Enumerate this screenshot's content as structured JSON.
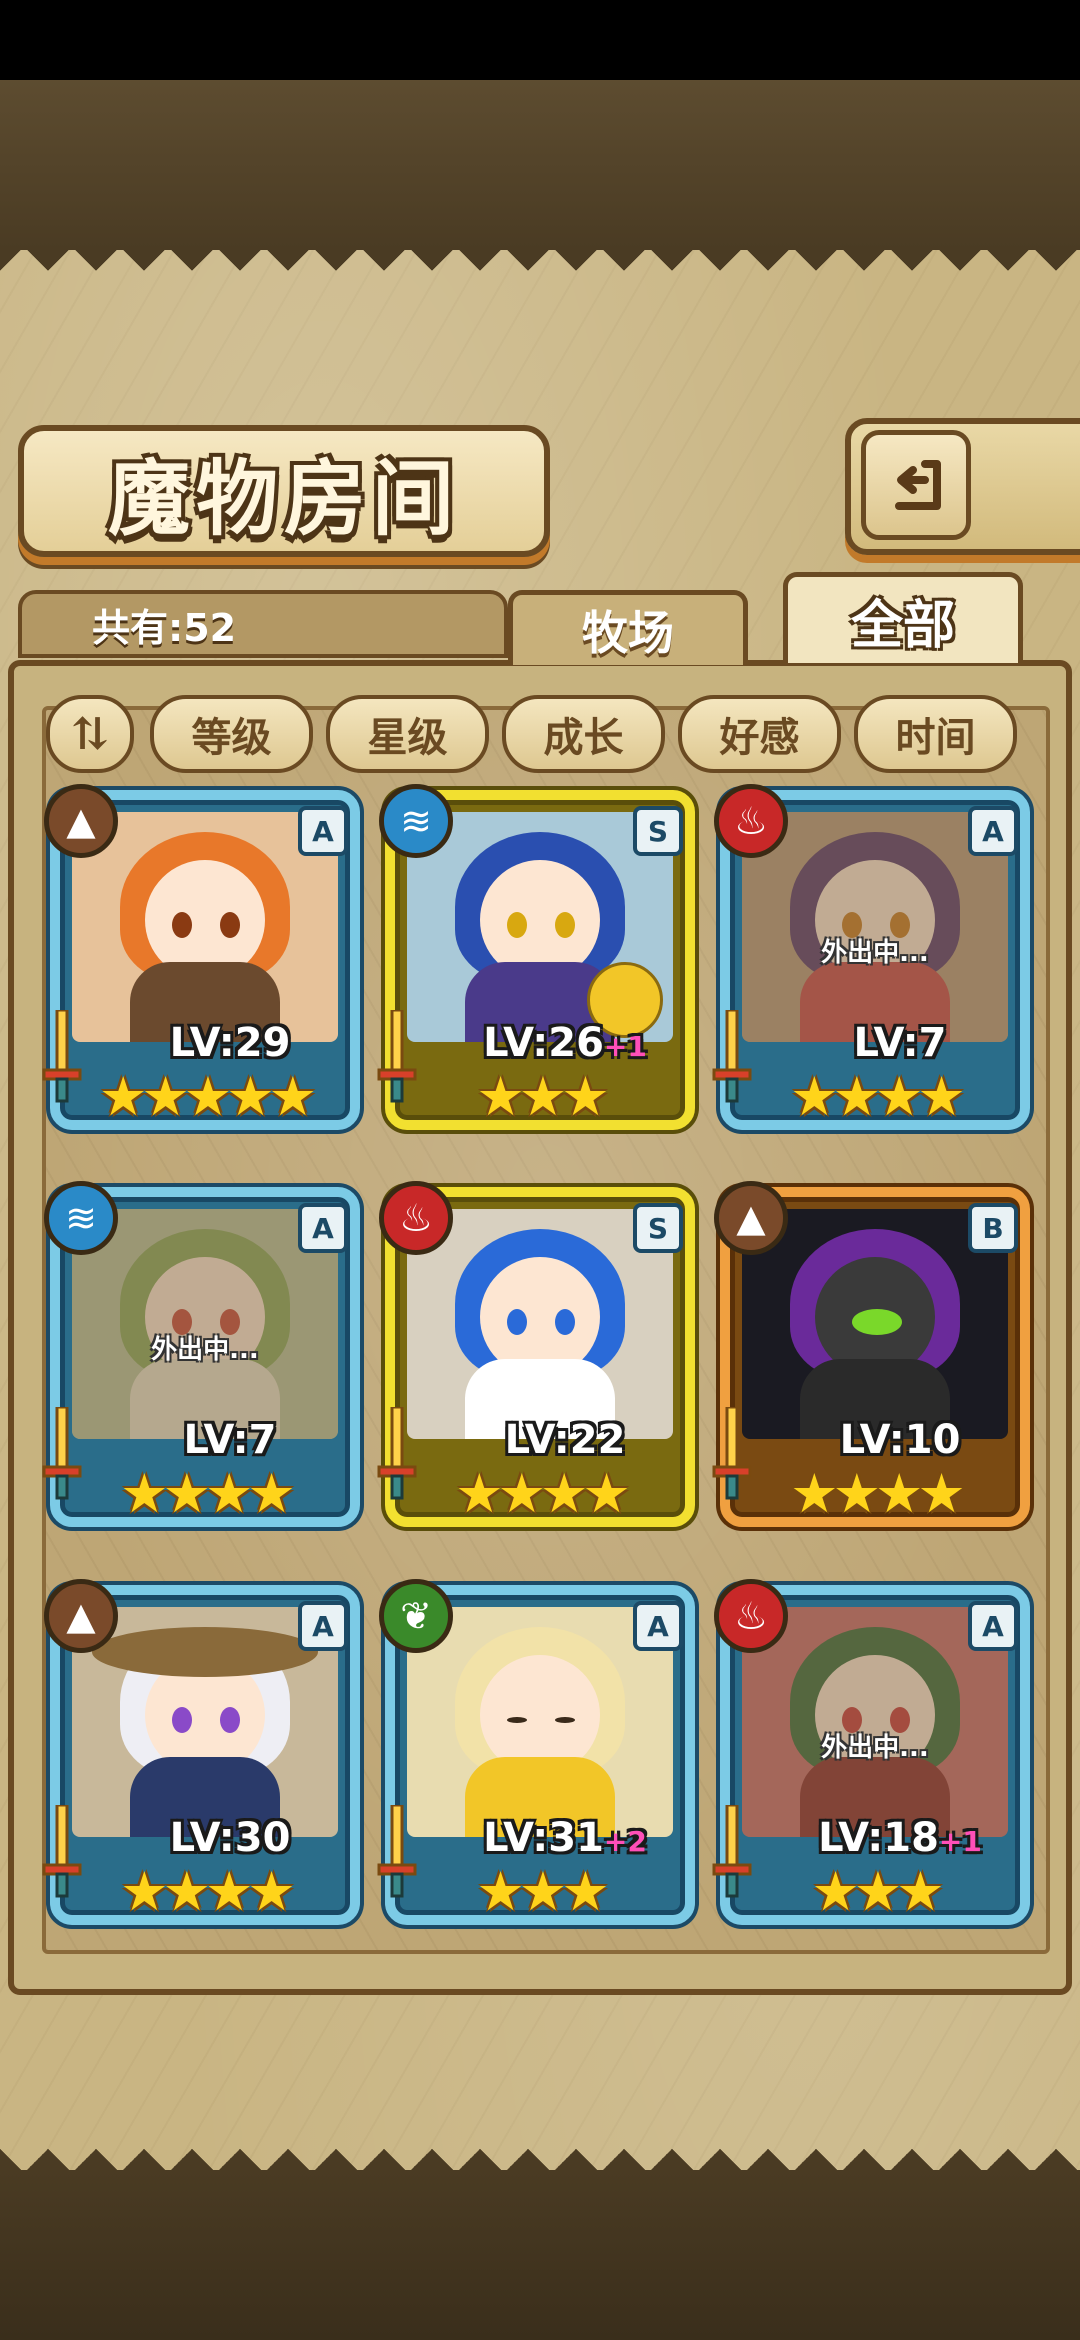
{
  "title": "魔物房间",
  "total_count": "共有:52",
  "tabs": [
    {
      "label": "牧场",
      "active": false
    },
    {
      "label": "全部",
      "active": true
    }
  ],
  "sort_toggle": "⇅",
  "filters": [
    "等级",
    "星级",
    "成长",
    "好感",
    "时间"
  ],
  "monsters": [
    {
      "element": "earth",
      "rarity": "A",
      "level": "LV:29",
      "plus": "",
      "stars": "★★★★★",
      "away": "",
      "frame": "blue"
    },
    {
      "element": "water",
      "rarity": "S",
      "level": "LV:26",
      "plus": "+1",
      "stars": "★★★",
      "away": "",
      "frame": "gold"
    },
    {
      "element": "fire",
      "rarity": "A",
      "level": "LV:7",
      "plus": "",
      "stars": "★★★★",
      "away": "外出中...",
      "frame": "blue"
    },
    {
      "element": "water",
      "rarity": "A",
      "level": "LV:7",
      "plus": "",
      "stars": "★★★★",
      "away": "外出中...",
      "frame": "blue"
    },
    {
      "element": "fire",
      "rarity": "S",
      "level": "LV:22",
      "plus": "",
      "stars": "★★★★",
      "away": "",
      "frame": "gold"
    },
    {
      "element": "earth",
      "rarity": "B",
      "level": "LV:10",
      "plus": "",
      "stars": "★★★★",
      "away": "",
      "frame": "orange"
    },
    {
      "element": "earth",
      "rarity": "A",
      "level": "LV:30",
      "plus": "",
      "stars": "★★★★",
      "away": "",
      "frame": "blue"
    },
    {
      "element": "nature",
      "rarity": "A",
      "level": "LV:31",
      "plus": "+2",
      "stars": "★★★",
      "away": "",
      "frame": "blue"
    },
    {
      "element": "fire",
      "rarity": "A",
      "level": "LV:18",
      "plus": "+1",
      "stars": "★★★",
      "away": "外出中...",
      "frame": "blue"
    }
  ],
  "icons": {
    "earth": "mountain-icon",
    "water": "waves-icon",
    "fire": "flame-icon",
    "nature": "leaf-icon",
    "back": "return-arrow-icon",
    "sword": "sword-icon"
  },
  "colors": {
    "earth": "#7a4a2a",
    "water": "#2a8ac8",
    "fire": "#c82828",
    "nature": "#3a8a2a",
    "star": "#ffd41a",
    "plus": "#ff4fb8"
  }
}
